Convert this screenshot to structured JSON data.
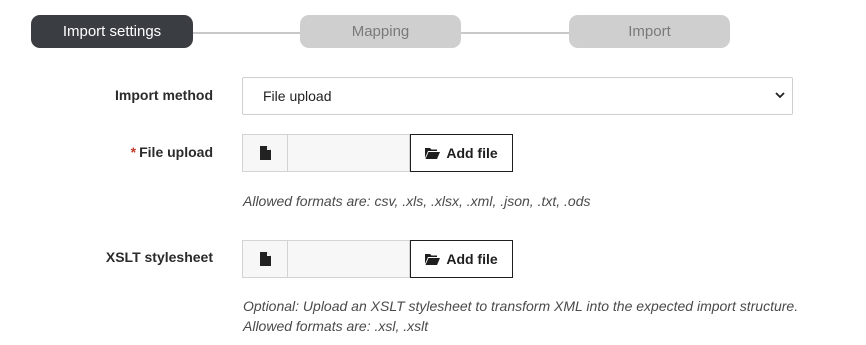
{
  "stepper": {
    "steps": [
      {
        "label": "Import settings",
        "state": "active"
      },
      {
        "label": "Mapping",
        "state": "inactive"
      },
      {
        "label": "Import",
        "state": "inactive"
      }
    ]
  },
  "form": {
    "import_method": {
      "label": "Import method",
      "selected": "File upload"
    },
    "file_upload": {
      "required_mark": "*",
      "label": "File upload",
      "button_label": "Add file",
      "help": "Allowed formats are: csv, .xls, .xlsx, .xml, .json, .txt, .ods"
    },
    "xslt": {
      "label": "XSLT stylesheet",
      "button_label": "Add file",
      "help_line1": "Optional: Upload an XSLT stylesheet to transform XML into the expected import structure.",
      "help_line2": "Allowed formats are: .xsl, .xslt"
    }
  },
  "colors": {
    "active_step": "#3a3d42",
    "inactive_step": "#cfcfcf",
    "required": "#c0392b"
  },
  "icons": [
    "file-icon",
    "folder-open-icon",
    "chevron-down-icon"
  ]
}
